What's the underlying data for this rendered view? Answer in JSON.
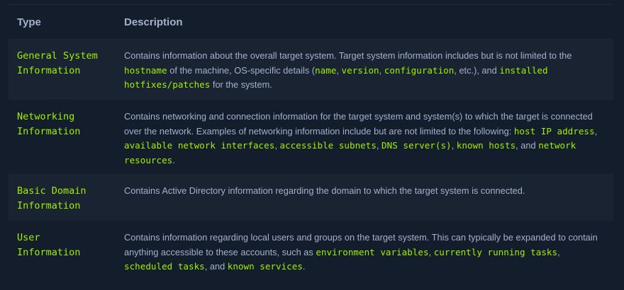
{
  "table": {
    "headers": [
      "Type",
      "Description"
    ],
    "rows": [
      {
        "type": [
          "General System",
          "Information"
        ],
        "desc": [
          {
            "t": "Contains information about the overall target system. Target system information includes but is not limited to the "
          },
          {
            "c": "hostname"
          },
          {
            "t": " of the machine, OS-specific details ("
          },
          {
            "c": "name"
          },
          {
            "t": ", "
          },
          {
            "c": "version"
          },
          {
            "t": ", "
          },
          {
            "c": "configuration"
          },
          {
            "t": ", etc.), and "
          },
          {
            "c": "installed hotfixes/patches"
          },
          {
            "t": " for the system."
          }
        ]
      },
      {
        "type": [
          "Networking",
          "Information"
        ],
        "desc": [
          {
            "t": "Contains networking and connection information for the target system and system(s) to which the target is connected over the network. Examples of networking information include but are not limited to the following: "
          },
          {
            "c": "host IP address"
          },
          {
            "t": ", "
          },
          {
            "c": "available network interfaces"
          },
          {
            "t": ", "
          },
          {
            "c": "accessible subnets"
          },
          {
            "t": ", "
          },
          {
            "c": "DNS server(s)"
          },
          {
            "t": ", "
          },
          {
            "c": "known hosts"
          },
          {
            "t": ", and "
          },
          {
            "c": "network resources"
          },
          {
            "t": "."
          }
        ]
      },
      {
        "type": [
          "Basic Domain",
          "Information"
        ],
        "desc": [
          {
            "t": "Contains Active Directory information regarding the domain to which the target system is connected."
          }
        ]
      },
      {
        "type": [
          "User",
          "Information"
        ],
        "desc": [
          {
            "t": "Contains information regarding local users and groups on the target system. This can typically be expanded to contain anything accessible to these accounts, such as "
          },
          {
            "c": "environment variables"
          },
          {
            "t": ", "
          },
          {
            "c": "currently running tasks"
          },
          {
            "t": ", "
          },
          {
            "c": "scheduled tasks"
          },
          {
            "t": ", and "
          },
          {
            "c": "known services"
          },
          {
            "t": "."
          }
        ]
      }
    ]
  },
  "colors": {
    "background": "#141d2b",
    "row_alt": "#1a2332",
    "text": "#a4b1cd",
    "accent_green": "#9fef00"
  }
}
